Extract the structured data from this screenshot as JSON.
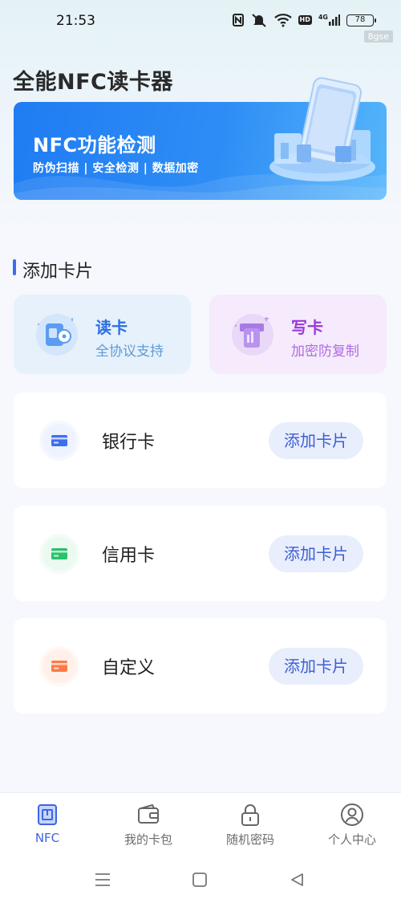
{
  "status_bar": {
    "time": "21:53",
    "battery": "78",
    "network": "4G",
    "hd_badge": "HD",
    "watermark": "8gse"
  },
  "app": {
    "title": "全能NFC读卡器"
  },
  "banner": {
    "title": "NFC功能检测",
    "subtitle": "防伪扫描 | 安全检测 | 数据加密"
  },
  "section": {
    "title": "添加卡片",
    "accent_color": "#3b6cf0"
  },
  "functions": [
    {
      "name": "读卡",
      "desc": "全协议支持",
      "icon": "read-card-icon"
    },
    {
      "name": "写卡",
      "desc": "加密防复制",
      "icon": "write-card-icon"
    }
  ],
  "card_types": [
    {
      "label": "银行卡",
      "button": "添加卡片",
      "icon": "bank-card-icon",
      "color": "#3d6ff0"
    },
    {
      "label": "信用卡",
      "button": "添加卡片",
      "icon": "credit-card-icon",
      "color": "#27c26a"
    },
    {
      "label": "自定义",
      "button": "添加卡片",
      "icon": "custom-card-icon",
      "color": "#ff7a45"
    }
  ],
  "bottom_nav": [
    {
      "label": "NFC",
      "icon": "nfc-icon",
      "active": true
    },
    {
      "label": "我的卡包",
      "icon": "wallet-icon",
      "active": false
    },
    {
      "label": "随机密码",
      "icon": "lock-icon",
      "active": false
    },
    {
      "label": "个人中心",
      "icon": "user-icon",
      "active": false
    }
  ]
}
